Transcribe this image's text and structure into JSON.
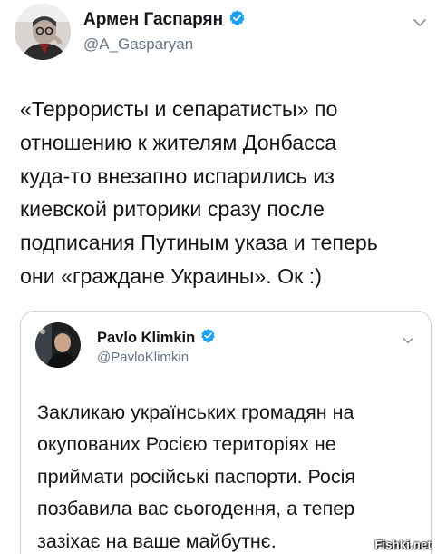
{
  "tweet": {
    "author_name": "Армен Гаспарян",
    "author_handle": "@A_Gasparyan",
    "verified": true,
    "text": "«Террористы и сепаратисты» по\nотношению к жителям Донбасса\nкуда-то внезапно испарились из\nкиевской риторики сразу после\nподписания Путиным указа и теперь\nони «граждане Украины». Ок :)"
  },
  "quoted_tweet": {
    "author_name": "Pavlo Klimkin",
    "author_handle": "@PavloKlimkin",
    "verified": true,
    "text": "Закликаю українських громадян на\nокупованих Росією територіях не\nприймати російські паспорти. Росія\nпозбавила вас сьогодення, а тепер\nзазіхає на ваше майбутнє."
  },
  "icons": {
    "verified": "verified-badge-icon",
    "more": "chevron-down-icon"
  },
  "colors": {
    "verified": "#1da1f2",
    "secondary_text": "#657786",
    "primary_text": "#14171a",
    "card_border": "#ccd6dd"
  },
  "watermark": "Fishki.net"
}
